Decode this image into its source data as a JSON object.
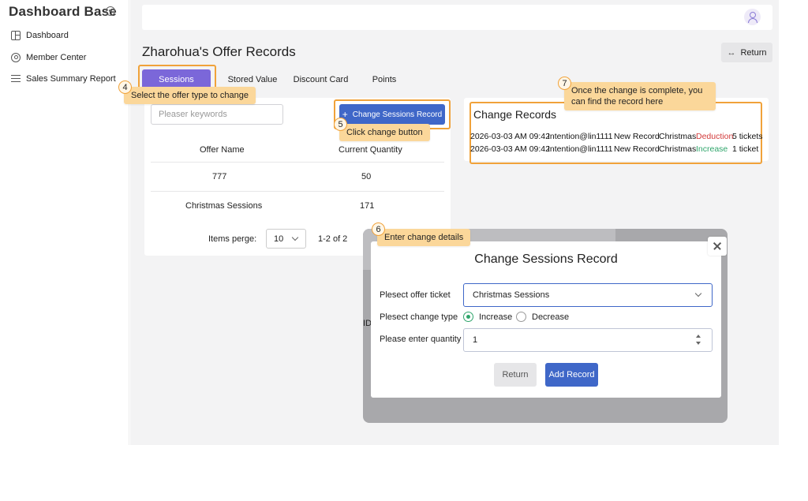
{
  "app": {
    "title": "Dashboard Base"
  },
  "sidebar": {
    "items": [
      {
        "label": "Dashboard",
        "icon": "dashboard-icon"
      },
      {
        "label": "Member Center",
        "icon": "user-circle-icon"
      },
      {
        "label": "Sales Summary Report",
        "icon": "list-icon"
      }
    ]
  },
  "header": {
    "page_title": "Zharohua's Offer Records",
    "return_label": "Return"
  },
  "tabs": [
    {
      "label": "Sessions",
      "active": true
    },
    {
      "label": "Stored Value",
      "active": false
    },
    {
      "label": "Discount Card",
      "active": false
    },
    {
      "label": "Points",
      "active": false
    }
  ],
  "search": {
    "placeholder": "Pleaser keywords"
  },
  "toolbar": {
    "change_button_label": "Change Sessions Record"
  },
  "table": {
    "columns": [
      "Offer Name",
      "Current Quantity"
    ],
    "rows": [
      {
        "name": "777",
        "qty": "50"
      },
      {
        "name": "Christmas Sessions",
        "qty": "171"
      }
    ]
  },
  "pagination": {
    "items_per_page_label": "Items perge:",
    "page_size": "10",
    "range": "1-2 of 2"
  },
  "change_records": {
    "title": "Change Records",
    "rows": [
      {
        "datetime": "2026-03-03 AM 09:42",
        "user": "Intention@lin1111",
        "action": "New Record",
        "offer": "Christmas",
        "type": "Deduction",
        "amount": "5 tickets"
      },
      {
        "datetime": "2026-03-03 AM 09:42",
        "user": "Intention@lin1111",
        "action": "New Record",
        "offer": "Christmas",
        "type": "Increase",
        "amount": "1 ticket"
      }
    ]
  },
  "callouts": {
    "c4": {
      "num": "4",
      "text": "Select the offer type to change"
    },
    "c5": {
      "num": "5",
      "text": "Click change button"
    },
    "c6": {
      "num": "6",
      "text": "Enter change details"
    },
    "c7": {
      "num": "7",
      "text": "Once the change is complete, you can find the record here"
    }
  },
  "modal": {
    "title": "Change Sessions Record",
    "offer_label": "Plesect offer ticket",
    "offer_value": "Christmas Sessions",
    "type_label": "Plesect change type",
    "type_options": [
      "Increase",
      "Decrease"
    ],
    "type_selected": "Increase",
    "qty_label": "Please enter quantity",
    "qty_value": "1",
    "return_label": "Return",
    "add_label": "Add Record",
    "background_fragment": "ID"
  },
  "colors": {
    "accent": "#7b67d9",
    "primary": "#3f67c8",
    "highlight": "#f0a23a",
    "callout": "#fbd79a",
    "deduction": "#d23a3a",
    "increase": "#2fa56b"
  }
}
